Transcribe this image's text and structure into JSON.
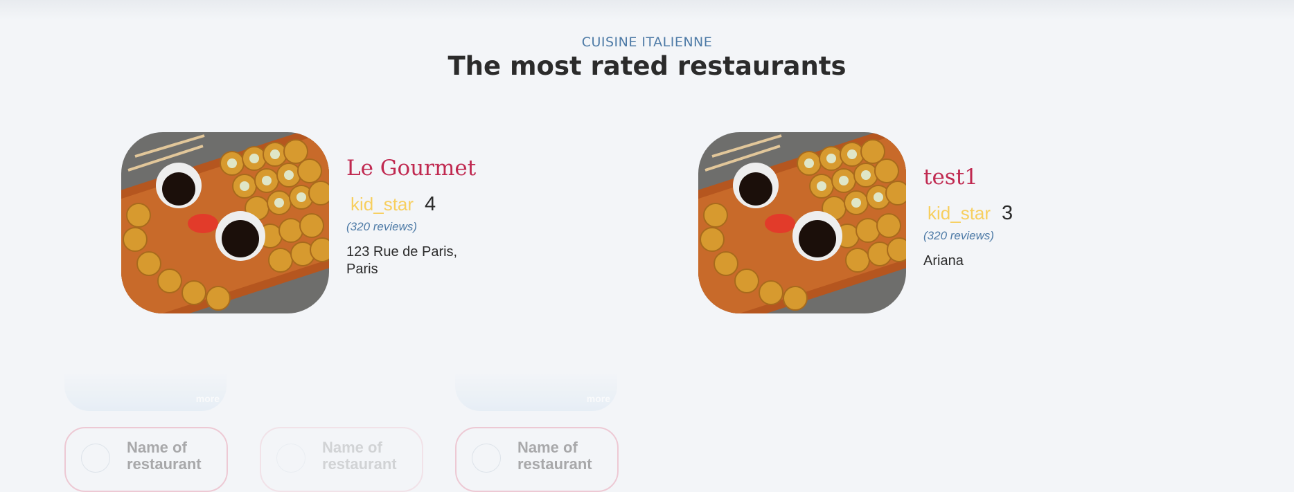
{
  "section": {
    "eyebrow": "CUISINE ITALIENNE",
    "title": "The most rated restaurants"
  },
  "restaurants": [
    {
      "name": "Le Gourmet",
      "star_icon": "kid_star",
      "rating": "4",
      "reviews": "(320 reviews)",
      "address": "123 Rue de Paris, Paris",
      "image": "sushi-platter"
    },
    {
      "name": "test1",
      "star_icon": "kid_star",
      "rating": "3",
      "reviews": "(320 reviews)",
      "address": "Ariana",
      "image": "sushi-platter"
    }
  ],
  "faded_cards": {
    "top_label": "more",
    "items": [
      {
        "name": "Name of restaurant"
      },
      {
        "name": "Name of restaurant"
      },
      {
        "name": "Name of restaurant"
      }
    ]
  },
  "colors": {
    "accent_red": "#c02950",
    "accent_blue": "#4d7aa6",
    "star_yellow": "#f7cf5e",
    "background": "#f3f5f8"
  }
}
